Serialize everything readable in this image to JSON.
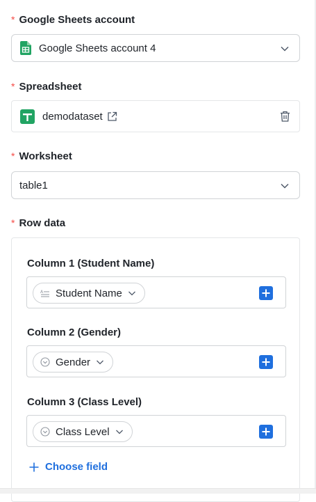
{
  "account": {
    "label": "Google Sheets account",
    "required_mark": "*",
    "value": "Google Sheets account 4",
    "icon": "google-sheets-icon"
  },
  "spreadsheet": {
    "label": "Spreadsheet",
    "required_mark": "*",
    "name": "demodataset",
    "icons": [
      "google-sheets-icon",
      "external-link-icon",
      "trash-icon"
    ]
  },
  "worksheet": {
    "label": "Worksheet",
    "required_mark": "*",
    "value": "table1"
  },
  "row_data": {
    "label": "Row data",
    "required_mark": "*",
    "columns": [
      {
        "label": "Column 1 (Student Name)",
        "field": "Student Name",
        "field_icon": "text-field-icon"
      },
      {
        "label": "Column 2 (Gender)",
        "field": "Gender",
        "field_icon": "single-select-icon"
      },
      {
        "label": "Column 3 (Class Level)",
        "field": "Class Level",
        "field_icon": "single-select-icon"
      }
    ],
    "choose_field": "Choose field"
  },
  "colors": {
    "accent": "#1f6fde",
    "required": "#f54a45",
    "sheets_green": "#21a463"
  }
}
